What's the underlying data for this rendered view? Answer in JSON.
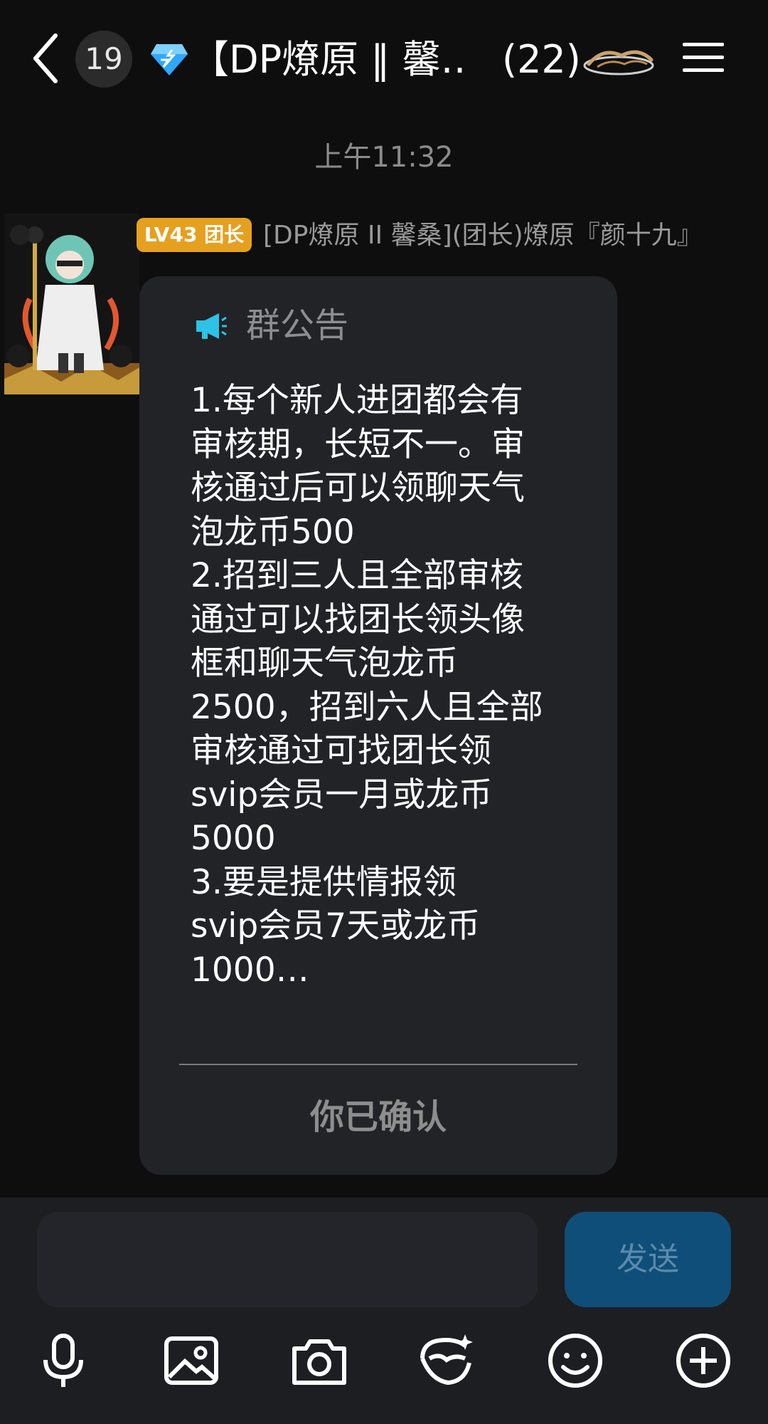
{
  "header": {
    "unread_count": "19",
    "group_title": "【DP燎原 ‖ 馨…",
    "member_count": "(22)",
    "gem_icon": "diamond-icon",
    "brand_icon": "destiny-logo"
  },
  "timestamp": "上午11:32",
  "message": {
    "level_badge": "LV43 团长",
    "sender_name": "[DP燎原 II 馨桑](团长)燎原『颜十九』",
    "announcement": {
      "title": "群公告",
      "body": "1.每个新人进团都会有\n审核期，长短不一。审\n核通过后可以领聊天气\n泡龙币500\n2.招到三人且全部审核\n通过可以找团长领头像\n框和聊天气泡龙币\n2500，招到六人且全部\n审核通过可找团长领\nsvip会员一月或龙币\n5000\n3.要是提供情报领\nsvip会员7天或龙币\n1000…",
      "confirm_label": "你已确认"
    }
  },
  "composer": {
    "input_value": "",
    "send_label": "发送",
    "tools": [
      "microphone-icon",
      "image-icon",
      "camera-icon",
      "avatar-mask-icon",
      "emoji-icon",
      "plus-icon"
    ]
  },
  "colors": {
    "background": "#0e0e0e",
    "card": "#222327",
    "badge": "#e6a020",
    "send_button": "#0f4e78"
  }
}
